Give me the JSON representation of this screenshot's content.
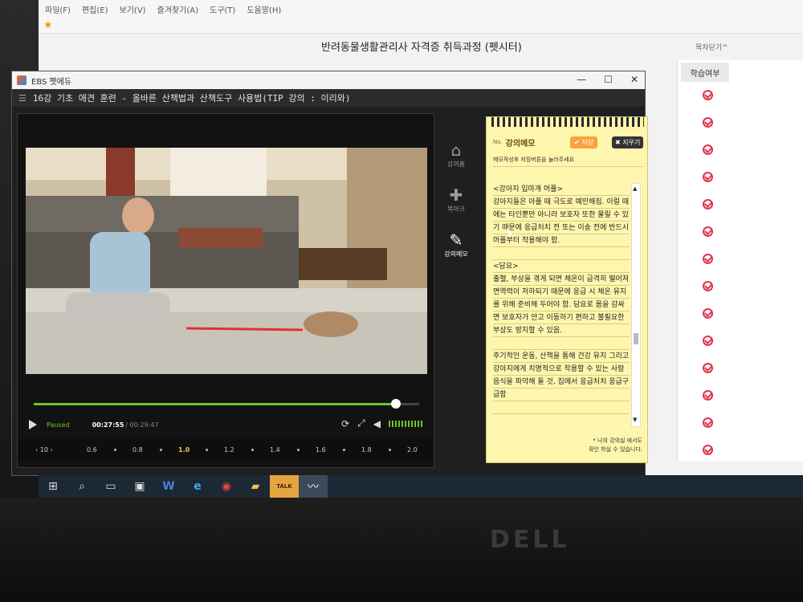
{
  "browser": {
    "menu": [
      "파일(F)",
      "편집(E)",
      "보기(V)",
      "즐겨찾기(A)",
      "도구(T)",
      "도움말(H)"
    ],
    "page_title": "반려동물생활관리사 자격증 취득과정 (펫시터)",
    "close_label": "목차닫기",
    "study_header": "학습여부",
    "check_count": 14
  },
  "player": {
    "app_name": "EBS 펫에듀",
    "window_controls": [
      "—",
      "☐",
      "✕"
    ],
    "lecture_title": "16강  기초 애견 훈련 - 올바른 산책법과 산책도구 사용법(TIP 강의 : 이리와)",
    "status": "Paused",
    "current_time": "00:27:55",
    "total_time": "/ 00:29:47",
    "progress": 0.94,
    "prev_label": "‹ 10 ›",
    "speeds": [
      "0.6",
      "0.8",
      "1.0",
      "1.2",
      "1.4",
      "1.6",
      "1.8",
      "2.0"
    ],
    "active_speed": "1.0"
  },
  "side_nav": [
    {
      "label": "강의홈",
      "icon": "home-icon"
    },
    {
      "label": "북마크",
      "icon": "bookmark-icon"
    },
    {
      "label": "강의메모",
      "icon": "memo-icon"
    }
  ],
  "memo": {
    "no": "No.",
    "title": "강의메모",
    "save_label": "✔ 저장",
    "clear_label": "✖ 지우기",
    "subtitle": "메모작성후 저장버튼을 눌러주세요",
    "body": "<강아지 입마개 머플>\n강아지들은 아플 때 극도로 예민해짐. 이럴 때에는 타인뿐만 아니라 보호자 또한 물릴 수 있기 때문에 응급처치 전 또는 이송 전에 반드시 머플부터 착용해야 함.\n\n<담요>\n출혈, 부상을 겪게 되면 체온이 급격히 떨어져 면역력이 저하되기 때문에 응급 시 체온 유지를 위해 준비해 두어야 함. 담요로 몸을 감싸면 보호자가 안고 이동하기 편하고 불필요한 부상도 방지할 수 있음.\n\n주기적인 운동, 산책을 통해 건강 유지 그리고 강아지에게 치명적으로 작용할 수 있는 사람음식을 파악해 둘 것, 집에서 응급처치 응급구급함",
    "footer": "* 나의 강의실 에서도\n확인 하실 수 있습니다."
  },
  "taskbar": [
    "windows-icon",
    "search-icon",
    "task-view-icon",
    "store-icon",
    "word-icon",
    "ie-icon",
    "chrome-icon",
    "folder-icon",
    "kakaotalk-icon",
    "player-icon"
  ],
  "taskbar_kakao": "TALK",
  "brand": "DELL"
}
